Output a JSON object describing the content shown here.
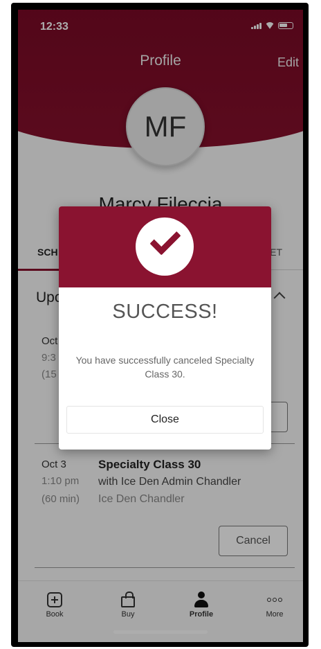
{
  "status_bar": {
    "time": "12:33"
  },
  "header": {
    "title": "Profile",
    "edit_label": "Edit"
  },
  "profile": {
    "initials": "MF",
    "name": "Marcy Fileccia"
  },
  "tabs": {
    "active": "SCH",
    "right": "ET"
  },
  "section": {
    "title": "Upcoming",
    "title_visible": "Up"
  },
  "bookings": [
    {
      "date": "Oct",
      "time": "9:3",
      "duration": "(15"
    },
    {
      "date": "Oct 3",
      "time": "1:10 pm",
      "duration": "(60 min)",
      "title": "Specialty Class 30",
      "instructor": "with Ice Den Admin Chandler",
      "location": "Ice Den Chandler",
      "cancel_label": "Cancel"
    }
  ],
  "tab_bar": [
    {
      "label": "Book",
      "icon": "plus-square-icon"
    },
    {
      "label": "Buy",
      "icon": "shopping-bag-icon"
    },
    {
      "label": "Profile",
      "icon": "person-icon"
    },
    {
      "label": "More",
      "icon": "more-dots-icon"
    }
  ],
  "modal": {
    "title": "SUCCESS!",
    "message": "You have successfully canceled Specialty Class 30.",
    "close_label": "Close"
  },
  "colors": {
    "brand": "#86102c",
    "overlay": "rgba(0,0,0,0.32)"
  }
}
